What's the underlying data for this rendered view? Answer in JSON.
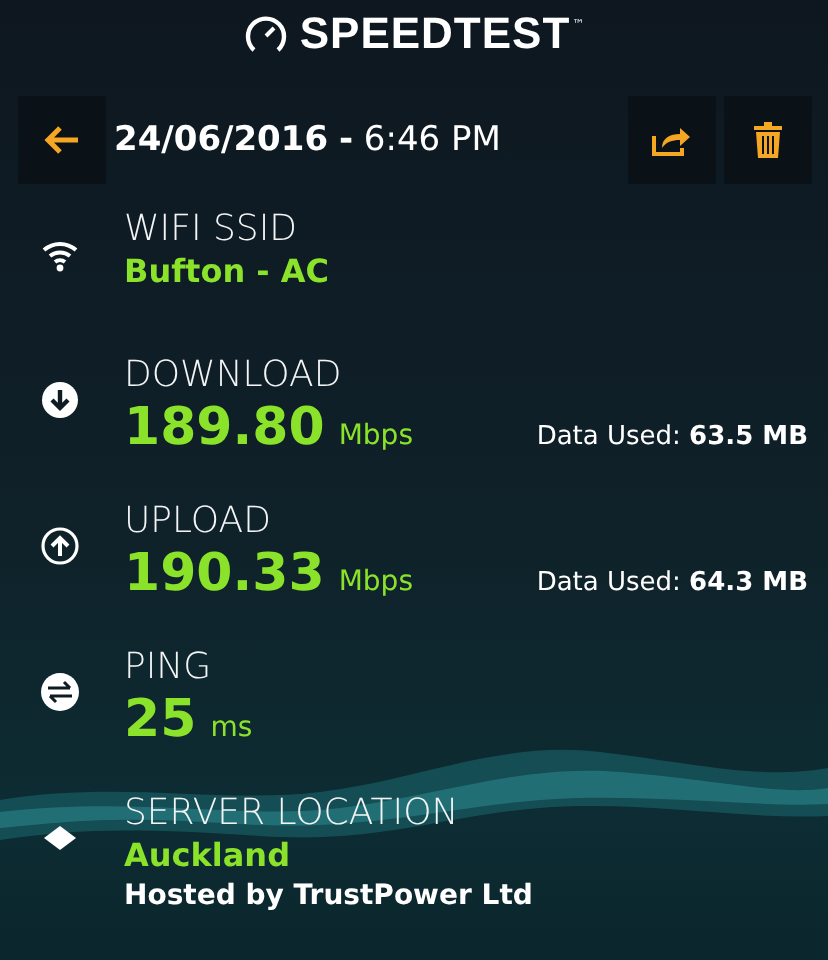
{
  "brand": {
    "name": "SPEEDTEST",
    "mark": "™"
  },
  "header": {
    "date": "24/06/2016",
    "separator": "-",
    "time": "6:46 PM"
  },
  "results": [
    {
      "kind": "wifi",
      "label": "WIFI SSID",
      "value": "Bufton - AC"
    },
    {
      "kind": "download",
      "label": "DOWNLOAD",
      "value": "189.80",
      "unit": "Mbps",
      "data_used": "Data Used: **63.5 MB**"
    },
    {
      "kind": "upload",
      "label": "UPLOAD",
      "value": "190.33",
      "unit": "Mbps",
      "data_used": "Data Used: **64.3 MB**"
    },
    {
      "kind": "ping",
      "label": "PING",
      "value": "25",
      "unit": "ms"
    },
    {
      "kind": "server",
      "label": "SERVER LOCATION",
      "value": "Auckland",
      "host": "Hosted by TrustPower Ltd"
    }
  ]
}
